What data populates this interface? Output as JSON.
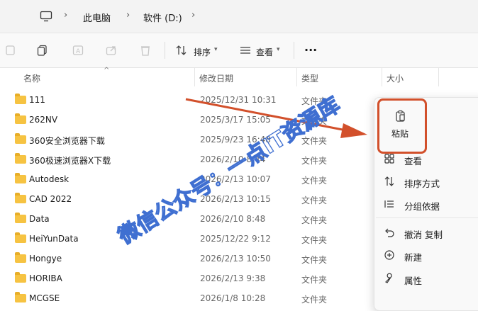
{
  "address": {
    "segments": [
      "此电脑",
      "软件 (D:)"
    ]
  },
  "toolbar": {
    "sort_label": "排序",
    "view_label": "查看",
    "more_label": "···"
  },
  "columns": {
    "name": "名称",
    "date": "修改日期",
    "type": "类型",
    "size": "大小"
  },
  "files": [
    {
      "name": "111",
      "date": "2025/12/31 10:31",
      "type": "文件夹"
    },
    {
      "name": "262NV",
      "date": "2025/3/17 15:05",
      "type": "文件夹"
    },
    {
      "name": "360安全浏览器下载",
      "date": "2025/9/23 16:48",
      "type": "文件夹"
    },
    {
      "name": "360极速浏览器X下载",
      "date": "2026/2/10 8:44",
      "type": "文件夹"
    },
    {
      "name": "Autodesk",
      "date": "2026/2/13 10:07",
      "type": "文件夹"
    },
    {
      "name": "CAD 2022",
      "date": "2026/2/13 10:15",
      "type": "文件夹"
    },
    {
      "name": "Data",
      "date": "2026/2/10 8:48",
      "type": "文件夹"
    },
    {
      "name": "HeiYunData",
      "date": "2025/12/22 9:12",
      "type": "文件夹"
    },
    {
      "name": "Hongye",
      "date": "2026/2/13 10:50",
      "type": "文件夹"
    },
    {
      "name": "HORIBA",
      "date": "2026/2/13 9:38",
      "type": "文件夹"
    },
    {
      "name": "MCGSE",
      "date": "2026/1/8 10:28",
      "type": "文件夹"
    }
  ],
  "context_menu": {
    "paste_label": "粘贴",
    "items": [
      {
        "label": "查看",
        "icon": "grid-view-icon"
      },
      {
        "label": "排序方式",
        "icon": "sort-arrows-icon"
      },
      {
        "label": "分组依据",
        "icon": "group-list-icon"
      },
      {
        "label": "撤消 复制",
        "icon": "undo-icon"
      },
      {
        "label": "新建",
        "icon": "plus-circle-icon"
      },
      {
        "label": "属性",
        "icon": "wrench-icon"
      }
    ]
  },
  "watermark": {
    "text": "微信公众号：一点IT资源库"
  },
  "colors": {
    "highlight": "#d2502b",
    "folder": "#f6c342",
    "watermark": "#3f6fd1"
  }
}
